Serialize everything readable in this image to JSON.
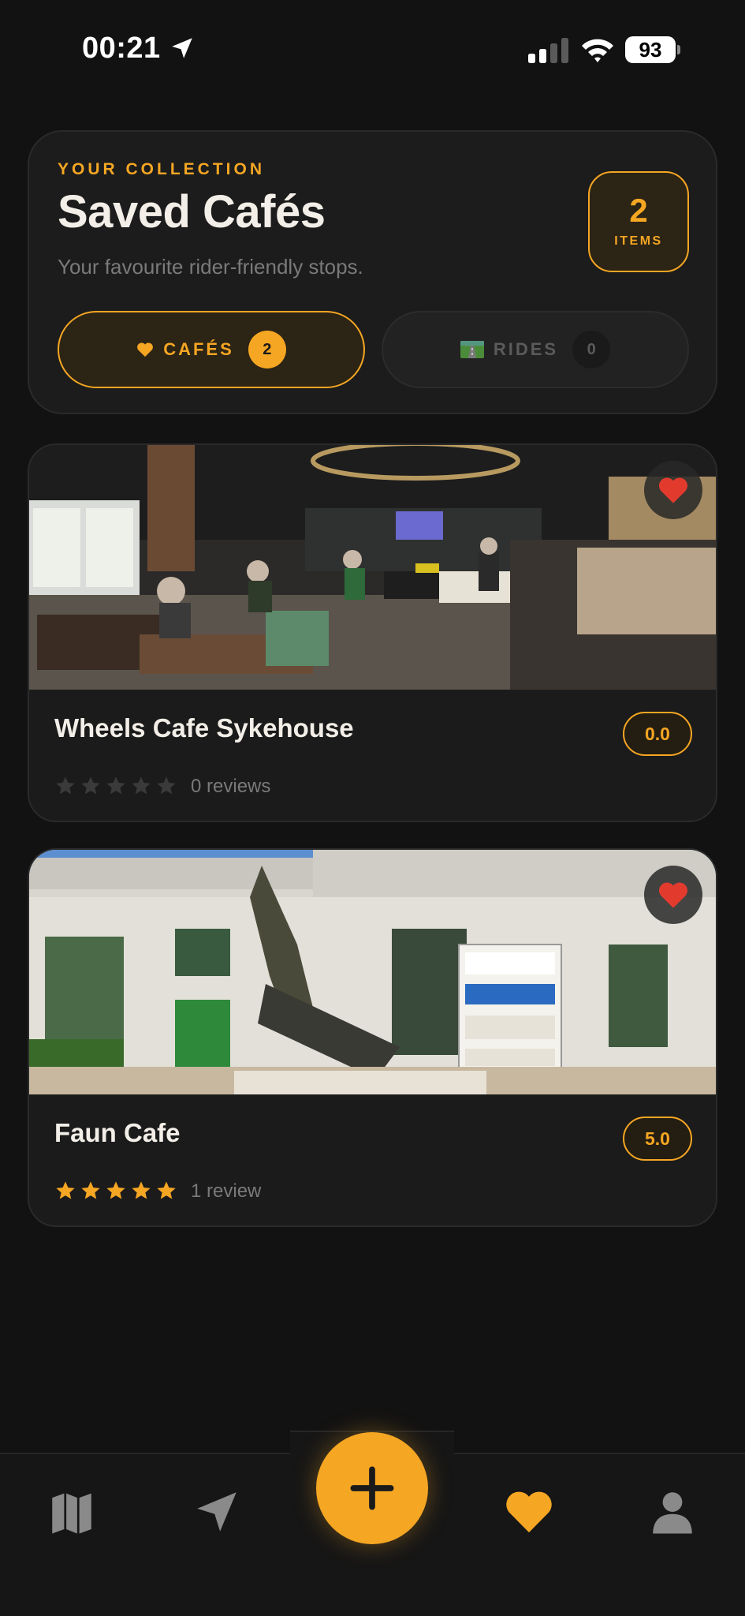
{
  "status_bar": {
    "time": "00:21",
    "battery": "93"
  },
  "header": {
    "eyebrow": "YOUR COLLECTION",
    "title": "Saved Cafés",
    "subtitle": "Your favourite rider-friendly stops.",
    "count": "2",
    "count_label": "ITEMS"
  },
  "tabs": [
    {
      "label": "CAFÉS",
      "count": "2",
      "icon": "heart-icon",
      "active": true
    },
    {
      "label": "RIDES",
      "count": "0",
      "icon": "road-icon",
      "active": false
    }
  ],
  "cafes": [
    {
      "name": "Wheels Cafe Sykehouse",
      "rating": "0.0",
      "stars": 0,
      "reviews": "0 reviews",
      "favourited": true
    },
    {
      "name": "Faun Cafe",
      "rating": "5.0",
      "stars": 5,
      "reviews": "1 review",
      "favourited": true
    }
  ],
  "bottom_nav": [
    {
      "icon": "map-icon",
      "active": false
    },
    {
      "icon": "navigate-arrow-icon",
      "active": false
    },
    {
      "icon": "plus-icon",
      "active": false
    },
    {
      "icon": "heart-icon",
      "active": true
    },
    {
      "icon": "person-icon",
      "active": false
    }
  ],
  "colors": {
    "accent": "#f5a623",
    "background": "#121212",
    "card": "#1c1c1c",
    "heart_red": "#e23b2e",
    "muted_text": "#7a7a7a"
  }
}
